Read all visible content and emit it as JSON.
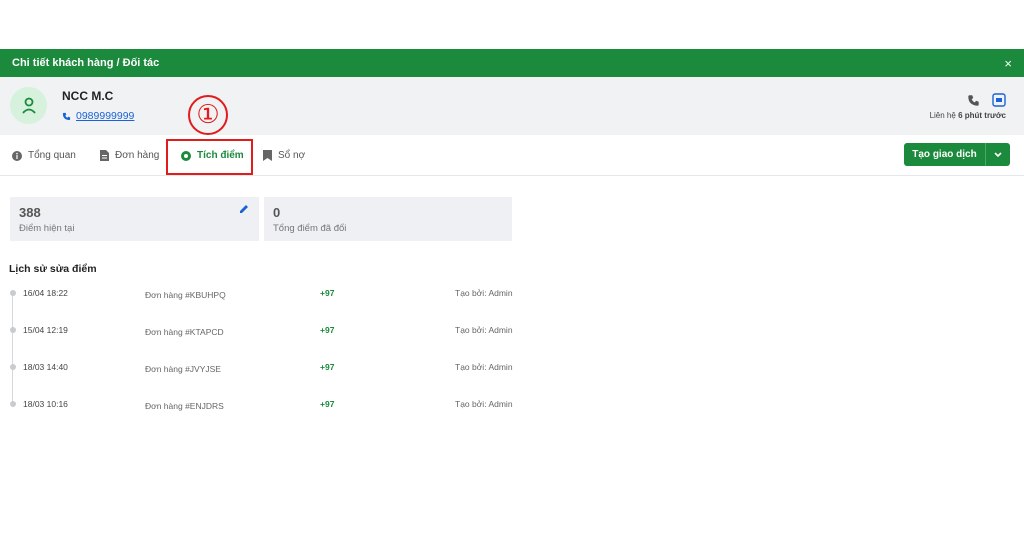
{
  "header": {
    "title": "Chi tiết khách hàng / Đối tác",
    "close": "×"
  },
  "customer": {
    "name": "NCC M.C",
    "phone": "0989999999",
    "contact_prefix": "Liên hệ",
    "contact_time": "6 phút trước"
  },
  "tabs": [
    {
      "label": "Tổng quan",
      "icon": "info-icon"
    },
    {
      "label": "Đơn hàng",
      "icon": "document-icon"
    },
    {
      "label": "Tích điểm",
      "icon": "points-icon",
      "active": true
    },
    {
      "label": "Sổ nợ",
      "icon": "bookmark-icon"
    }
  ],
  "annotation": {
    "step": "①"
  },
  "create_button": {
    "label": "Tạo giao dịch"
  },
  "stats": [
    {
      "value": "388",
      "label": "Điểm hiện tại"
    },
    {
      "value": "0",
      "label": "Tổng điểm đã đổi"
    }
  ],
  "history": {
    "title": "Lịch sử sửa điểm",
    "rows": [
      {
        "date": "16/04 18:22",
        "order": "Đơn hàng #KBUHPQ",
        "points": "+97",
        "by": "Tạo bởi: Admin"
      },
      {
        "date": "15/04 12:19",
        "order": "Đơn hàng #KTAPCD",
        "points": "+97",
        "by": "Tạo bởi: Admin"
      },
      {
        "date": "18/03 14:40",
        "order": "Đơn hàng #JVYJSE",
        "points": "+97",
        "by": "Tạo bởi: Admin"
      },
      {
        "date": "18/03 10:16",
        "order": "Đơn hàng #ENJDRS",
        "points": "+97",
        "by": "Tạo bởi: Admin"
      }
    ]
  },
  "colors": {
    "brand_green": "#1b8a3c",
    "highlight_red": "#e21b1b",
    "link_blue": "#1a63d6"
  }
}
